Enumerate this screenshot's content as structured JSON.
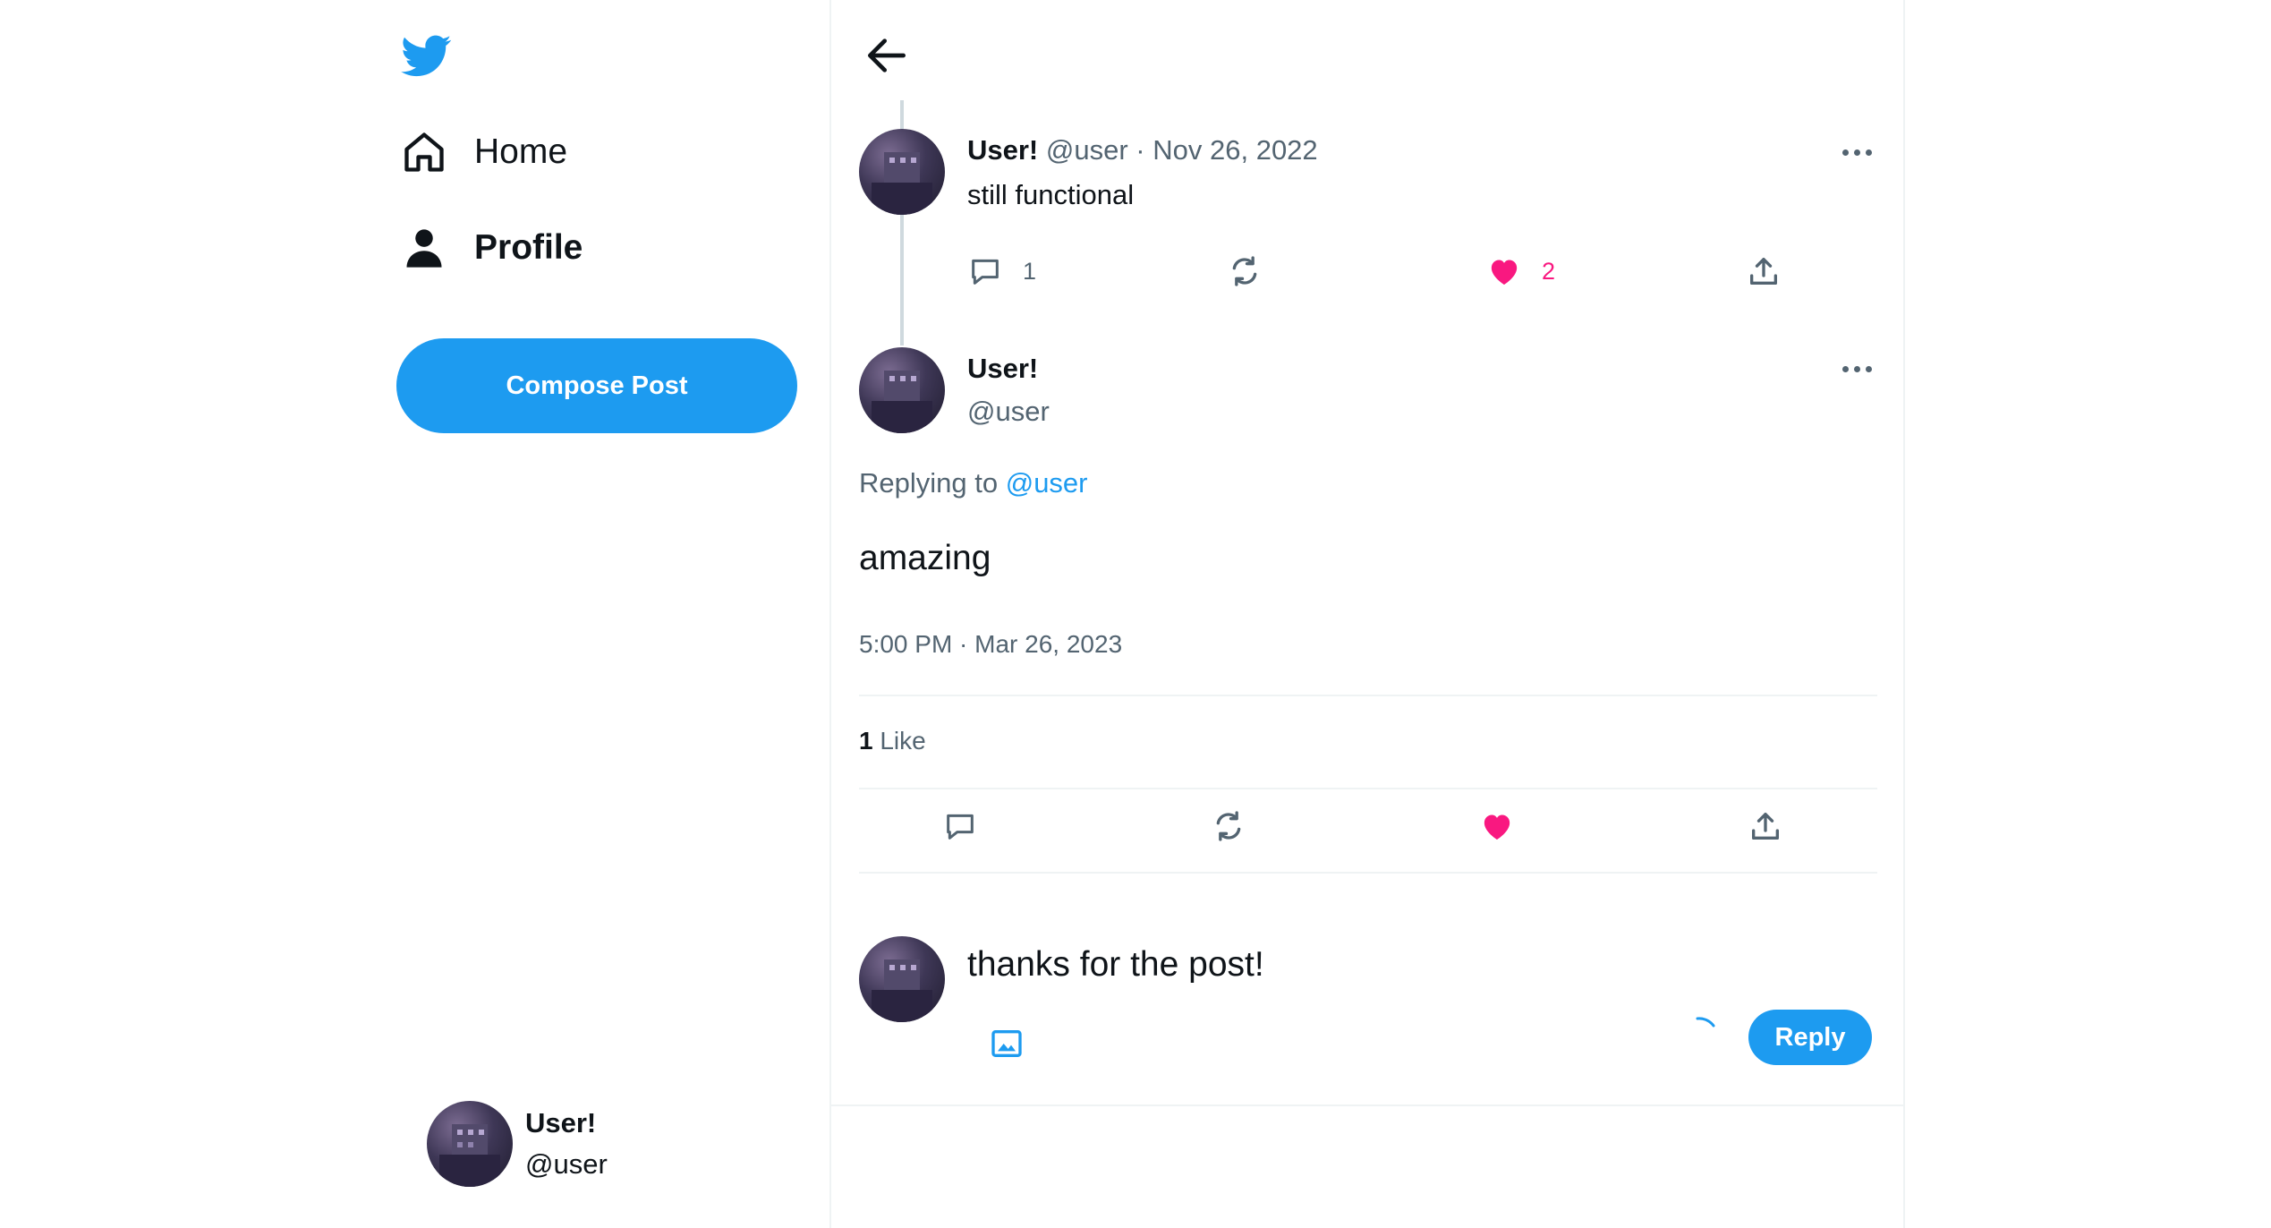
{
  "sidebar": {
    "logo_icon": "twitter-bird-icon",
    "nav": [
      {
        "label": "Home",
        "icon": "home-icon"
      },
      {
        "label": "Profile",
        "icon": "person-icon"
      }
    ],
    "compose_label": "Compose Post",
    "account": {
      "name": "User!",
      "handle": "@user"
    }
  },
  "thread": {
    "parent": {
      "name": "User!",
      "handle": "@user",
      "date": "Nov 26, 2022",
      "separator": "·",
      "text": "still functional",
      "reply_count": "1",
      "like_count": "2"
    },
    "focused": {
      "name": "User!",
      "handle": "@user",
      "replying_prefix": "Replying to",
      "replying_to": "@user",
      "text": "amazing",
      "timestamp": "5:00 PM · Mar 26, 2023",
      "likes_count": "1",
      "likes_label": "Like"
    }
  },
  "composer": {
    "value": "thanks for the post!",
    "reply_label": "Reply"
  },
  "colors": {
    "accent": "#1d9bf0",
    "like": "#f91880",
    "muted": "#536471"
  }
}
